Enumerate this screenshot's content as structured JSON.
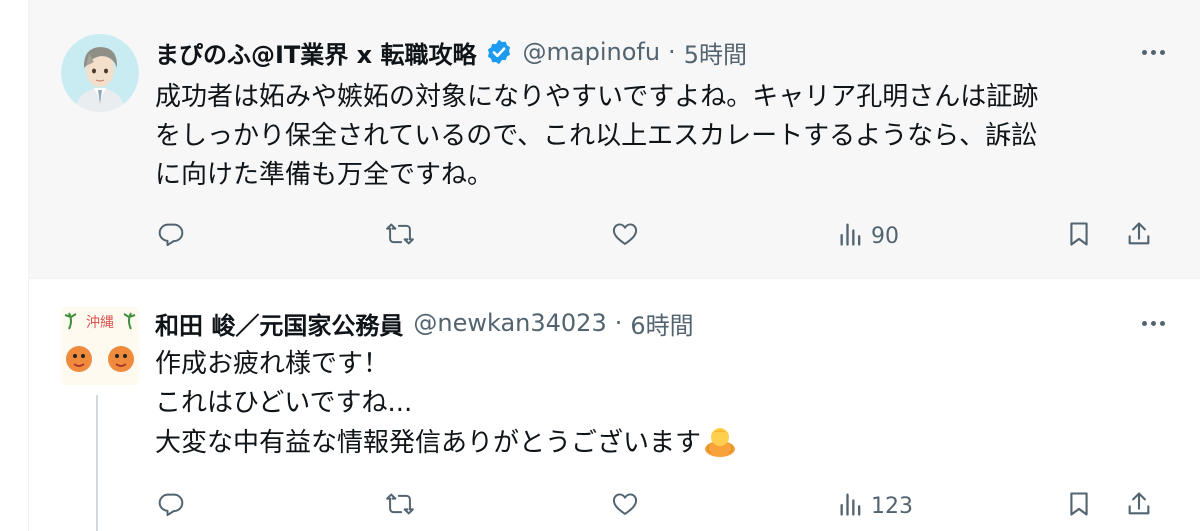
{
  "tweets": [
    {
      "name": "まぴのふ@IT業界 x 転職攻略",
      "verified": true,
      "handle": "@mapinofu",
      "separator": "·",
      "time": "5時間",
      "text": "成功者は妬みや嫉妬の対象になりやすいですよね。キャリア孔明さんは証跡\nをしっかり保全されているので、これ以上エスカレートするようなら、訴訟\nに向けた準備も万全ですね。",
      "views": "90",
      "colors": {
        "background": "#f7f7f7",
        "verified_badge": "#1d9bf0"
      }
    },
    {
      "name": "和田 峻／元国家公務員",
      "verified": false,
      "handle": "@newkan34023",
      "separator": "·",
      "time": "6時間",
      "text": "作成お疲れ様です！\nこれはひどいですね...\n大変な中有益な情報発信ありがとうございます",
      "trailing_emoji": "person-bowing-emoji",
      "avatar_text": "沖縄",
      "views": "123",
      "colors": {
        "background": "#ffffff"
      }
    }
  ],
  "icons": [
    "reply-icon",
    "retweet-icon",
    "like-icon",
    "views-icon",
    "bookmark-icon",
    "share-icon",
    "more-icon",
    "verified-badge-icon"
  ],
  "colors": {
    "text": "#0f1419",
    "secondary": "#536471",
    "border": "#eff3f4",
    "thread_line": "#cfd9de"
  }
}
